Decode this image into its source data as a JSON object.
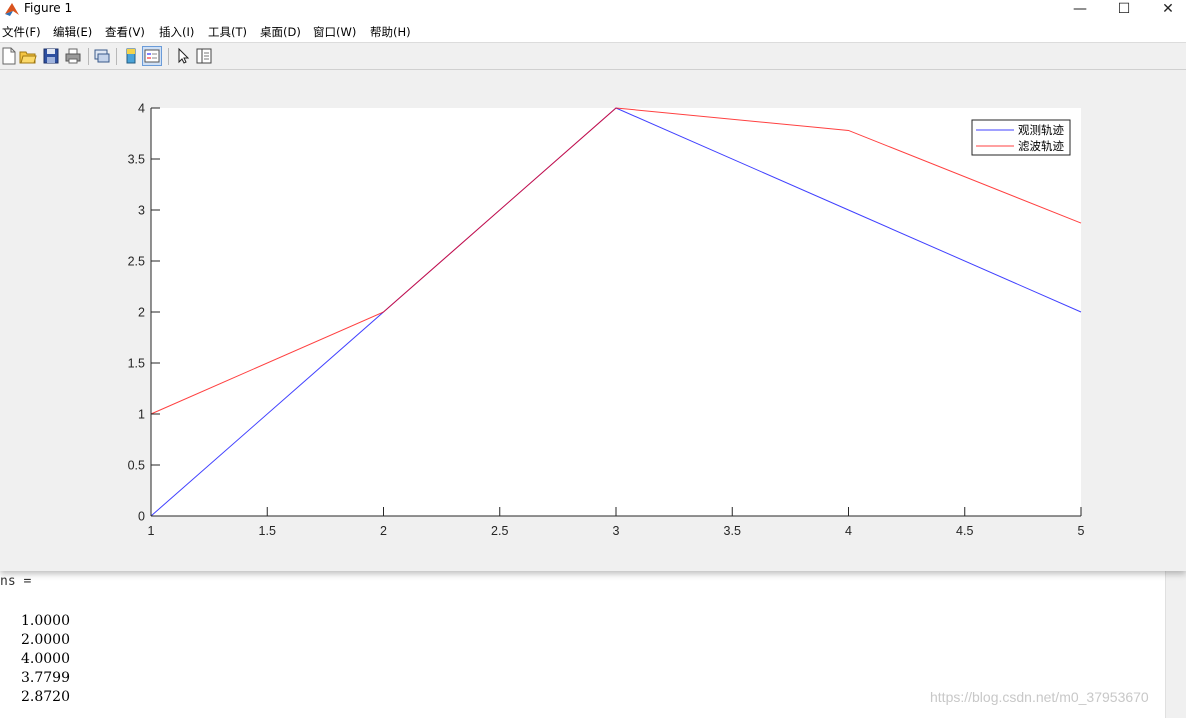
{
  "window": {
    "title": "Figure 1"
  },
  "menu": [
    "文件(F)",
    "编辑(E)",
    "查看(V)",
    "插入(I)",
    "工具(T)",
    "桌面(D)",
    "窗口(W)",
    "帮助(H)"
  ],
  "toolbar": [
    "new-figure-icon",
    "open-folder-icon",
    "save-icon",
    "print-icon",
    "link-icon",
    "colorbar-icon",
    "legend-icon",
    "pointer-icon",
    "property-inspector-icon"
  ],
  "chart_data": {
    "type": "line",
    "title": "",
    "xlabel": "",
    "ylabel": "",
    "xlim": [
      1,
      5
    ],
    "ylim": [
      0,
      4
    ],
    "xticks": [
      1,
      1.5,
      2,
      2.5,
      3,
      3.5,
      4,
      4.5,
      5
    ],
    "yticks": [
      0,
      0.5,
      1,
      1.5,
      2,
      2.5,
      3,
      3.5,
      4
    ],
    "x": [
      1,
      2,
      3,
      4,
      5
    ],
    "series": [
      {
        "name": "观测轨迹",
        "color": "#0000ff",
        "values": [
          0,
          2,
          4,
          3,
          2
        ]
      },
      {
        "name": "滤波轨迹",
        "color": "#ff0000",
        "values": [
          1,
          2,
          4,
          3.7799,
          2.872
        ]
      }
    ],
    "legend": "top-right",
    "grid": false
  },
  "console": {
    "label": "ns =",
    "values": [
      "1.0000",
      "2.0000",
      "4.0000",
      "3.7799",
      "2.8720"
    ]
  },
  "watermark": "https://blog.csdn.net/m0_37953670"
}
